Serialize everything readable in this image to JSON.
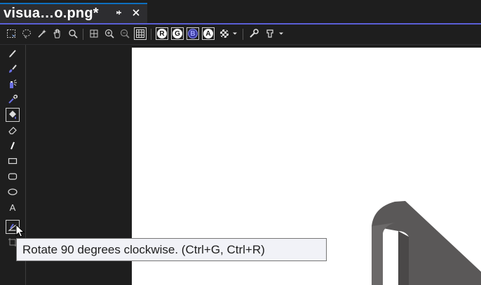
{
  "tab": {
    "title": "visua…o.png*",
    "pin_icon": "pin-icon",
    "close_icon": "close-icon"
  },
  "toolbar": {
    "channel_buttons": [
      "R",
      "G",
      "B",
      "A"
    ],
    "icons": [
      "rectangle-select-icon",
      "lasso-select-icon",
      "magic-wand-icon",
      "pan-hand-icon",
      "zoom-icon",
      "actual-size-icon",
      "zoom-in-icon",
      "zoom-out-icon",
      "pixel-grid-icon",
      "red-channel-icon",
      "green-channel-icon",
      "blue-channel-icon",
      "alpha-channel-icon",
      "background-checker-icon",
      "dropdown-icon",
      "properties-wrench-icon",
      "advanced-dropdown-icon"
    ]
  },
  "tools": [
    "pencil-icon",
    "brush-icon",
    "airbrush-icon",
    "eyedropper-icon",
    "fill-bucket-icon",
    "eraser-icon",
    "line-icon",
    "rectangle-icon",
    "rounded-rectangle-icon",
    "ellipse-icon",
    "text-icon",
    "rotate-icon"
  ],
  "tooltip": {
    "text": "Rotate 90 degrees clockwise. (Ctrl+G, Ctrl+R)"
  },
  "colors": {
    "accent": "#5a5fd6",
    "chrome": "#1e1e1e",
    "canvas": "#ffffff",
    "shape": "#5a5858"
  }
}
